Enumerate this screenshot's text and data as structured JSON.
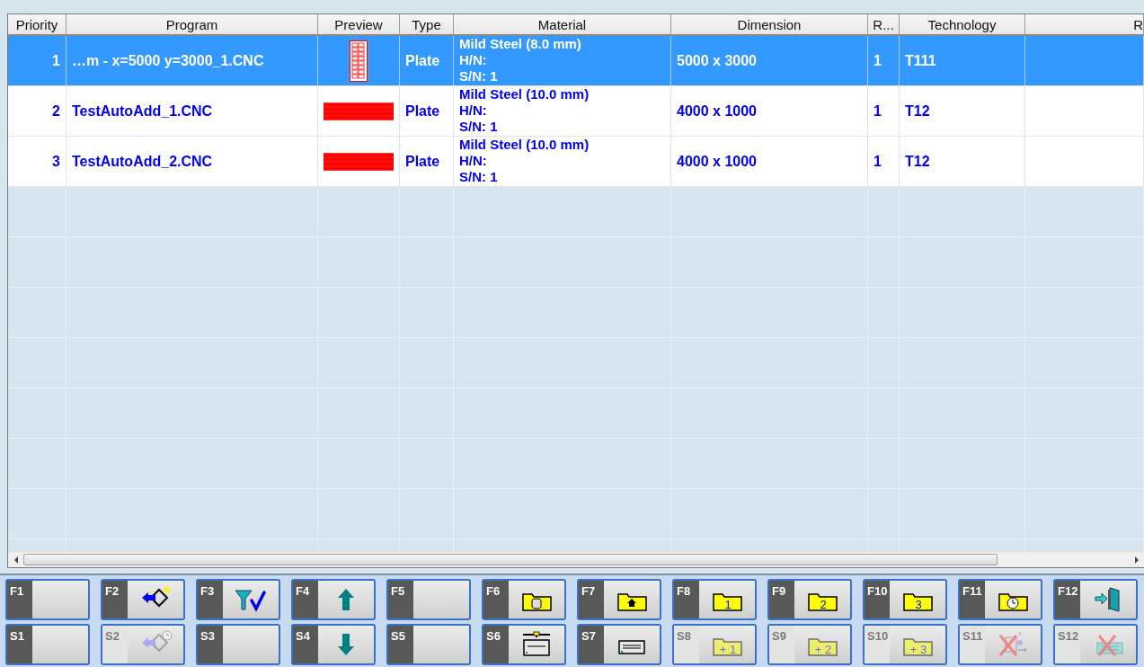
{
  "table": {
    "columns": [
      "Priority",
      "Program",
      "Preview",
      "Type",
      "Material",
      "Dimension",
      "R...",
      "Technology",
      "R"
    ],
    "rows": [
      {
        "selected": true,
        "priority": "1",
        "program": "…m - x=5000 y=3000_1.CNC",
        "kind": "tall",
        "type": "Plate",
        "material": [
          "Mild Steel (8.0 mm)",
          "H/N:",
          "S/N: 1"
        ],
        "dimension": "5000 x 3000",
        "column_7": "1",
        "technology": "T111"
      },
      {
        "selected": false,
        "priority": "2",
        "program": "TestAutoAdd_1.CNC",
        "kind": "wide",
        "type": "Plate",
        "material": [
          "Mild Steel (10.0 mm)",
          "H/N:",
          "S/N: 1"
        ],
        "dimension": "4000 x 1000",
        "column_7": "1",
        "technology": "T12"
      },
      {
        "selected": false,
        "priority": "3",
        "program": "TestAutoAdd_2.CNC",
        "kind": "wide",
        "type": "Plate",
        "material": [
          "Mild Steel (10.0 mm)",
          "H/N:",
          "S/N: 1"
        ],
        "dimension": "4000 x 1000",
        "column_7": "1",
        "technology": "T12"
      }
    ]
  },
  "function_keys": [
    {
      "key": "F1",
      "kind": "blank",
      "disabled": false
    },
    {
      "key": "F2",
      "kind": "import",
      "disabled": false
    },
    {
      "key": "F3",
      "kind": "filter",
      "disabled": false
    },
    {
      "key": "F4",
      "kind": "up",
      "disabled": false
    },
    {
      "key": "F5",
      "kind": "blank",
      "disabled": false
    },
    {
      "key": "F6",
      "kind": "folderdb",
      "disabled": false
    },
    {
      "key": "F7",
      "kind": "folderhome",
      "disabled": false
    },
    {
      "key": "F8",
      "kind": "folder",
      "badge": "1",
      "disabled": false
    },
    {
      "key": "F9",
      "kind": "folder",
      "badge": "2",
      "disabled": false
    },
    {
      "key": "F10",
      "kind": "folder",
      "badge": "3",
      "disabled": false
    },
    {
      "key": "F11",
      "kind": "folderclock",
      "disabled": false
    },
    {
      "key": "F12",
      "kind": "exit",
      "disabled": false
    }
  ],
  "shift_keys": [
    {
      "key": "S1",
      "kind": "blank",
      "disabled": false
    },
    {
      "key": "S2",
      "kind": "importclock",
      "disabled": true
    },
    {
      "key": "S3",
      "kind": "blank",
      "disabled": false
    },
    {
      "key": "S4",
      "kind": "down",
      "disabled": false
    },
    {
      "key": "S5",
      "kind": "blank",
      "disabled": false
    },
    {
      "key": "S6",
      "kind": "machine",
      "disabled": false
    },
    {
      "key": "S7",
      "kind": "tray",
      "disabled": false
    },
    {
      "key": "S8",
      "kind": "folder",
      "badge": "+ 1",
      "disabled": true
    },
    {
      "key": "S9",
      "kind": "folder",
      "badge": "+ 2",
      "disabled": true
    },
    {
      "key": "S10",
      "kind": "folder",
      "badge": "+ 3",
      "disabled": true
    },
    {
      "key": "S11",
      "kind": "deletetransfer",
      "disabled": true
    },
    {
      "key": "S12",
      "kind": "deletemsg",
      "disabled": true
    }
  ]
}
